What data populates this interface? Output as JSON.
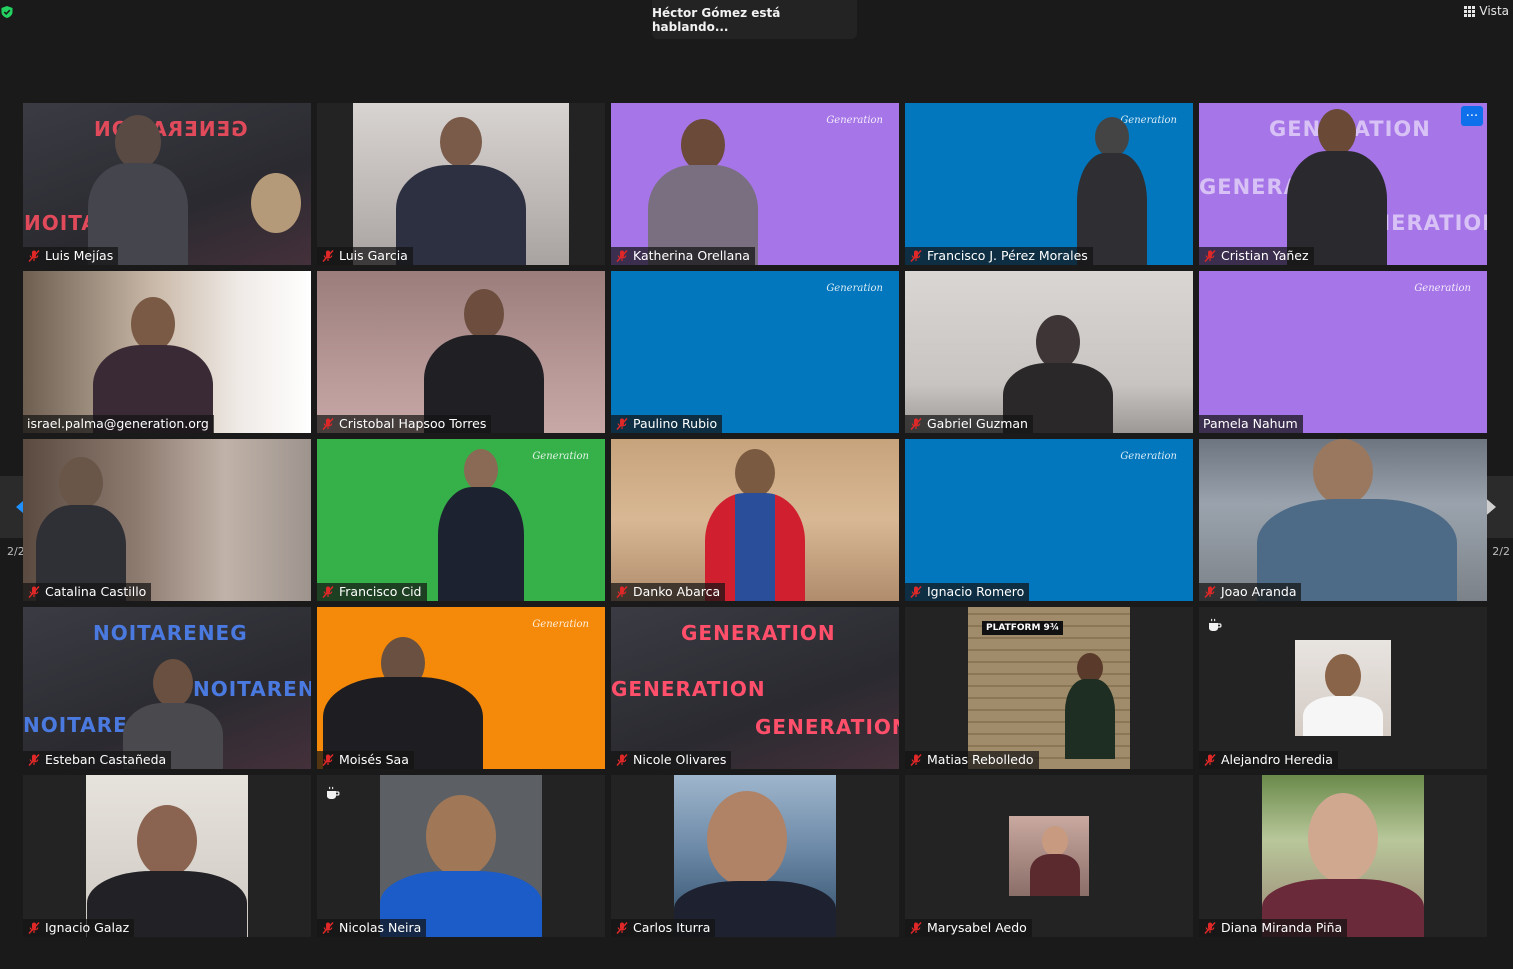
{
  "status": {
    "speaking_text": "Héctor Gómez está hablando..."
  },
  "view_button": {
    "label": "Vista"
  },
  "pagination": {
    "left_label": "2/2",
    "right_label": "2/2"
  },
  "logo_text": "Generation",
  "participants": [
    {
      "name": "Luis Mejías",
      "muted": true,
      "bg": "dark-gen"
    },
    {
      "name": "Luis Garcia",
      "muted": true,
      "bg": "room"
    },
    {
      "name": "Katherina Orellana",
      "muted": true,
      "bg": "purple"
    },
    {
      "name": "Francisco J. Pérez Morales",
      "muted": true,
      "bg": "blue"
    },
    {
      "name": "Cristian Yañez",
      "muted": true,
      "bg": "purple"
    },
    {
      "name": "israel.palma@generation.org",
      "muted": false,
      "bg": "office"
    },
    {
      "name": "Cristobal Hapsoo Torres",
      "muted": true,
      "bg": "pink"
    },
    {
      "name": "Paulino Rubio",
      "muted": true,
      "bg": "blue"
    },
    {
      "name": "Gabriel Guzman",
      "muted": true,
      "bg": "greywall"
    },
    {
      "name": "Pamela Nahum",
      "muted": false,
      "bg": "purple"
    },
    {
      "name": "Catalina Castillo",
      "muted": true,
      "bg": "blurroom"
    },
    {
      "name": "Francisco Cid",
      "muted": true,
      "bg": "green"
    },
    {
      "name": "Danko Abarca",
      "muted": true,
      "bg": "warm"
    },
    {
      "name": "Ignacio Romero",
      "muted": true,
      "bg": "blue"
    },
    {
      "name": "Joao Aranda",
      "muted": true,
      "bg": "outdoor"
    },
    {
      "name": "Esteban Castañeda",
      "muted": true,
      "bg": "dark-gen"
    },
    {
      "name": "Moisés Saa",
      "muted": true,
      "bg": "orange"
    },
    {
      "name": "Nicole Olivares",
      "muted": true,
      "bg": "dark-gen"
    },
    {
      "name": "Matias Rebolledo",
      "muted": true,
      "bg": "brick"
    },
    {
      "name": "Alejandro Heredia",
      "muted": true,
      "bg": "photo-white"
    },
    {
      "name": "Ignacio Galaz",
      "muted": true,
      "bg": "photo-room"
    },
    {
      "name": "Nicolas Neira",
      "muted": true,
      "bg": "photo-grey"
    },
    {
      "name": "Carlos Iturra",
      "muted": true,
      "bg": "photo-sea"
    },
    {
      "name": "Marysabel Aedo",
      "muted": true,
      "bg": "photo-small"
    },
    {
      "name": "Diana Miranda Piña",
      "muted": true,
      "bg": "photo-garden"
    }
  ],
  "gen_overlay": {
    "word": "GENERATION",
    "mirrored_a": "GENERATION",
    "mirrored_b": "NOITARENEG",
    "platform_sign": "PLATFORM 9¾"
  },
  "colors": {
    "window_bg": "#1a1a1a",
    "tile_bg": "#232323",
    "accent_blue": "#0e71eb",
    "muted_red": "#e02828",
    "shield_green": "#23d160"
  }
}
